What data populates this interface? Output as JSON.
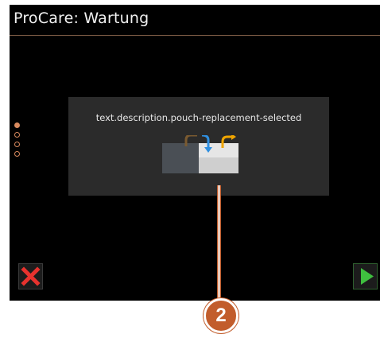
{
  "header": {
    "title": "ProCare: Wartung"
  },
  "pager": {
    "total_steps": 4,
    "active_step": 1
  },
  "dialog": {
    "description": "text.description.pouch-replacement-selected",
    "graphic_icon": "pouch-replacement-icon"
  },
  "footer": {
    "cancel_icon": "close-icon",
    "next_icon": "play-arrow-icon"
  },
  "callout": {
    "number": "2"
  },
  "colors": {
    "accent": "#d98a5f",
    "cancel": "#e8322e",
    "next": "#3fbf3f",
    "callout": "#c25d2c",
    "arrow_blue": "#2f8fe0",
    "arrow_yellow": "#f0a500"
  }
}
